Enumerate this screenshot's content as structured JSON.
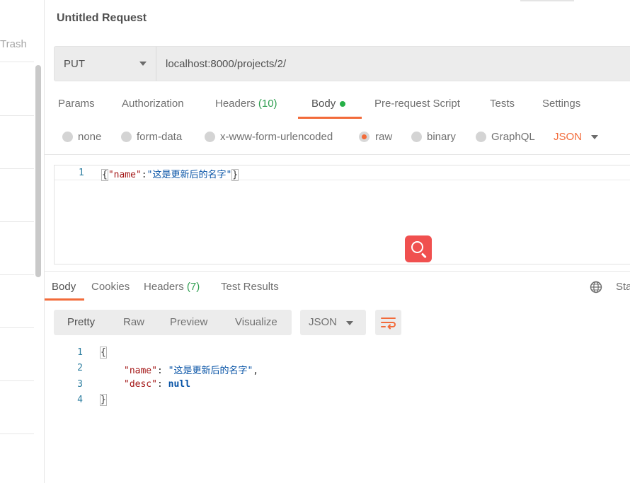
{
  "sidebar": {
    "trash_label": "Trash"
  },
  "request": {
    "title": "Untitled Request",
    "method": "PUT",
    "url": "localhost:8000/projects/2/"
  },
  "request_tabs": {
    "params": "Params",
    "authorization": "Authorization",
    "headers": "Headers",
    "headers_count": "(10)",
    "body": "Body",
    "prerequest": "Pre-request Script",
    "tests": "Tests",
    "settings": "Settings"
  },
  "body_modes": {
    "none": "none",
    "form_data": "form-data",
    "urlencoded": "x-www-form-urlencoded",
    "raw": "raw",
    "binary": "binary",
    "graphql": "GraphQL",
    "selected": "raw",
    "type": "JSON"
  },
  "editor": {
    "line_number": "1",
    "open": "{",
    "key": "\"name\"",
    "colon": ":",
    "value": "\"这是更新后的名字\"",
    "close": "}"
  },
  "response_tabs": {
    "body": "Body",
    "cookies": "Cookies",
    "headers": "Headers",
    "headers_count": "(7)",
    "test_results": "Test Results",
    "status_partial": "Sta"
  },
  "response_view": {
    "pretty": "Pretty",
    "raw": "Raw",
    "preview": "Preview",
    "visualize": "Visualize",
    "format": "JSON"
  },
  "response_body": {
    "lines": [
      {
        "n": "1",
        "open": "{"
      },
      {
        "n": "2",
        "key": "\"name\"",
        "sep": ": ",
        "value": "\"这是更新后的名字\"",
        "tail": ","
      },
      {
        "n": "3",
        "key": "\"desc\"",
        "sep": ": ",
        "kw": "null"
      },
      {
        "n": "4",
        "close": "}"
      }
    ]
  },
  "colors": {
    "accent": "#f26b3a",
    "active_dot": "#26b047",
    "count_green": "#2e9e4f",
    "search_fab": "#f0504f"
  },
  "icons": {
    "method_dropdown": "chevron-down-icon",
    "search_fab": "search-icon",
    "globe": "globe-icon",
    "wrap": "wrap-lines-icon"
  }
}
